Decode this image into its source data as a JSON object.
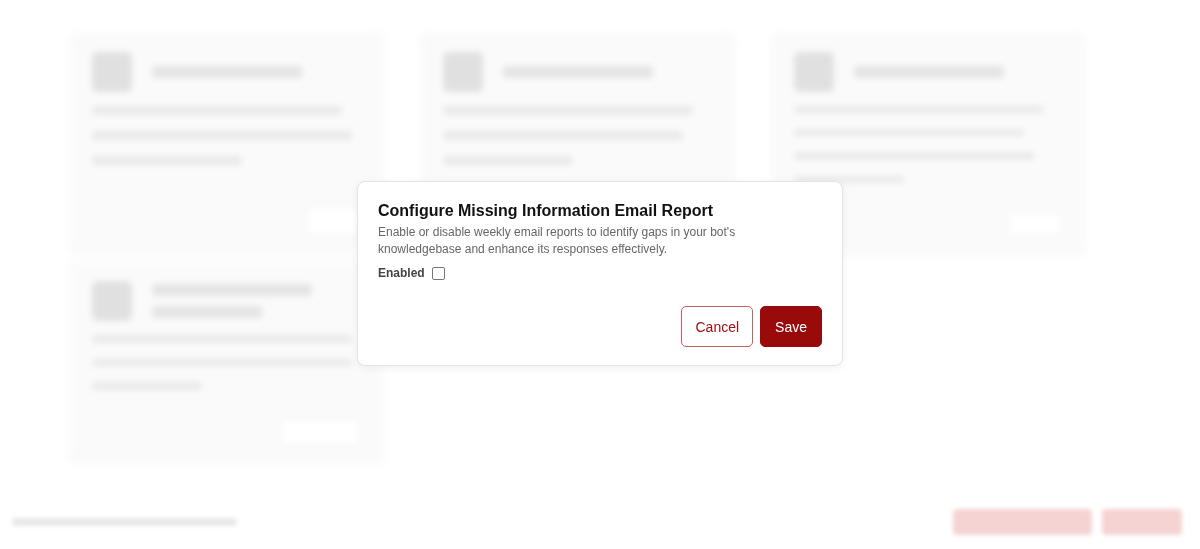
{
  "dialog": {
    "title": "Configure Missing Information Email Report",
    "description": "Enable or disable weekly email reports to identify gaps in your bot's knowledgebase and enhance its responses effectively.",
    "enabled": {
      "label": "Enabled",
      "checked": false
    },
    "buttons": [
      {
        "label": "Cancel",
        "kind": "secondary"
      },
      {
        "label": "Save",
        "kind": "primary"
      }
    ]
  }
}
